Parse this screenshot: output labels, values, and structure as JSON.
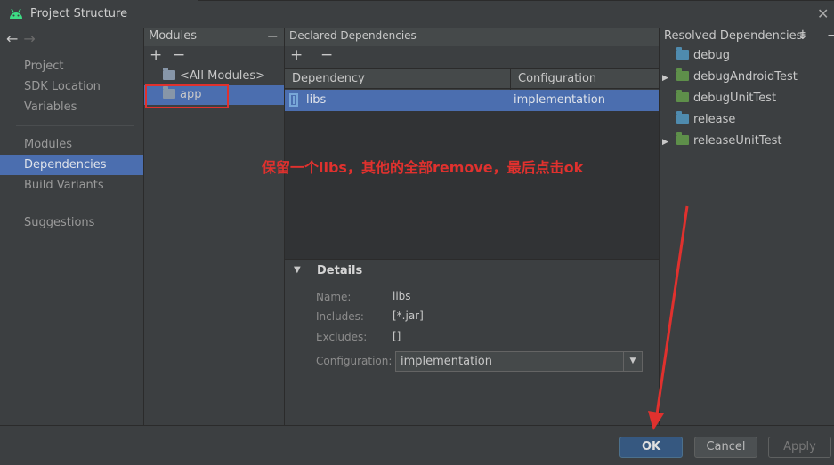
{
  "window": {
    "title": "Project Structure",
    "close_icon": "close-icon"
  },
  "nav": {
    "items": [
      {
        "label": "Project"
      },
      {
        "label": "SDK Location"
      },
      {
        "label": "Variables"
      },
      {
        "label": "Modules"
      },
      {
        "label": "Dependencies",
        "selected": true
      },
      {
        "label": "Build Variants"
      },
      {
        "label": "Suggestions"
      }
    ]
  },
  "modules": {
    "header": "Modules",
    "add": "+",
    "remove": "−",
    "items": [
      {
        "label": "<All Modules>"
      },
      {
        "label": "app",
        "selected": true
      }
    ]
  },
  "declared": {
    "header": "Declared Dependencies",
    "add": "+",
    "remove": "−",
    "columns": [
      "Dependency",
      "Configuration"
    ],
    "rows": [
      {
        "dependency": "libs",
        "configuration": "implementation"
      }
    ],
    "details": {
      "title": "Details",
      "name_label": "Name:",
      "name_value": "libs",
      "includes_label": "Includes:",
      "includes_value": "[*.jar]",
      "excludes_label": "Excludes:",
      "excludes_value": "[]",
      "configuration_label": "Configuration:",
      "configuration_value": "implementation"
    }
  },
  "resolved": {
    "header": "Resolved Dependencies",
    "items": [
      {
        "label": "debug",
        "expandable": false,
        "color": "#4f8bae"
      },
      {
        "label": "debugAndroidTest",
        "expandable": true,
        "color": "#5e8f4a"
      },
      {
        "label": "debugUnitTest",
        "expandable": false,
        "color": "#5e8f4a"
      },
      {
        "label": "release",
        "expandable": false,
        "color": "#4f8bae"
      },
      {
        "label": "releaseUnitTest",
        "expandable": true,
        "color": "#5e8f4a"
      }
    ]
  },
  "annotation": {
    "text": "保留一个libs，其他的全部remove，最后点击ok",
    "color": "#e0312e"
  },
  "footer": {
    "ok": "OK",
    "cancel": "Cancel",
    "apply": "Apply"
  },
  "colors": {
    "accent": "#4b6eaf",
    "highlight": "#e0312e"
  }
}
